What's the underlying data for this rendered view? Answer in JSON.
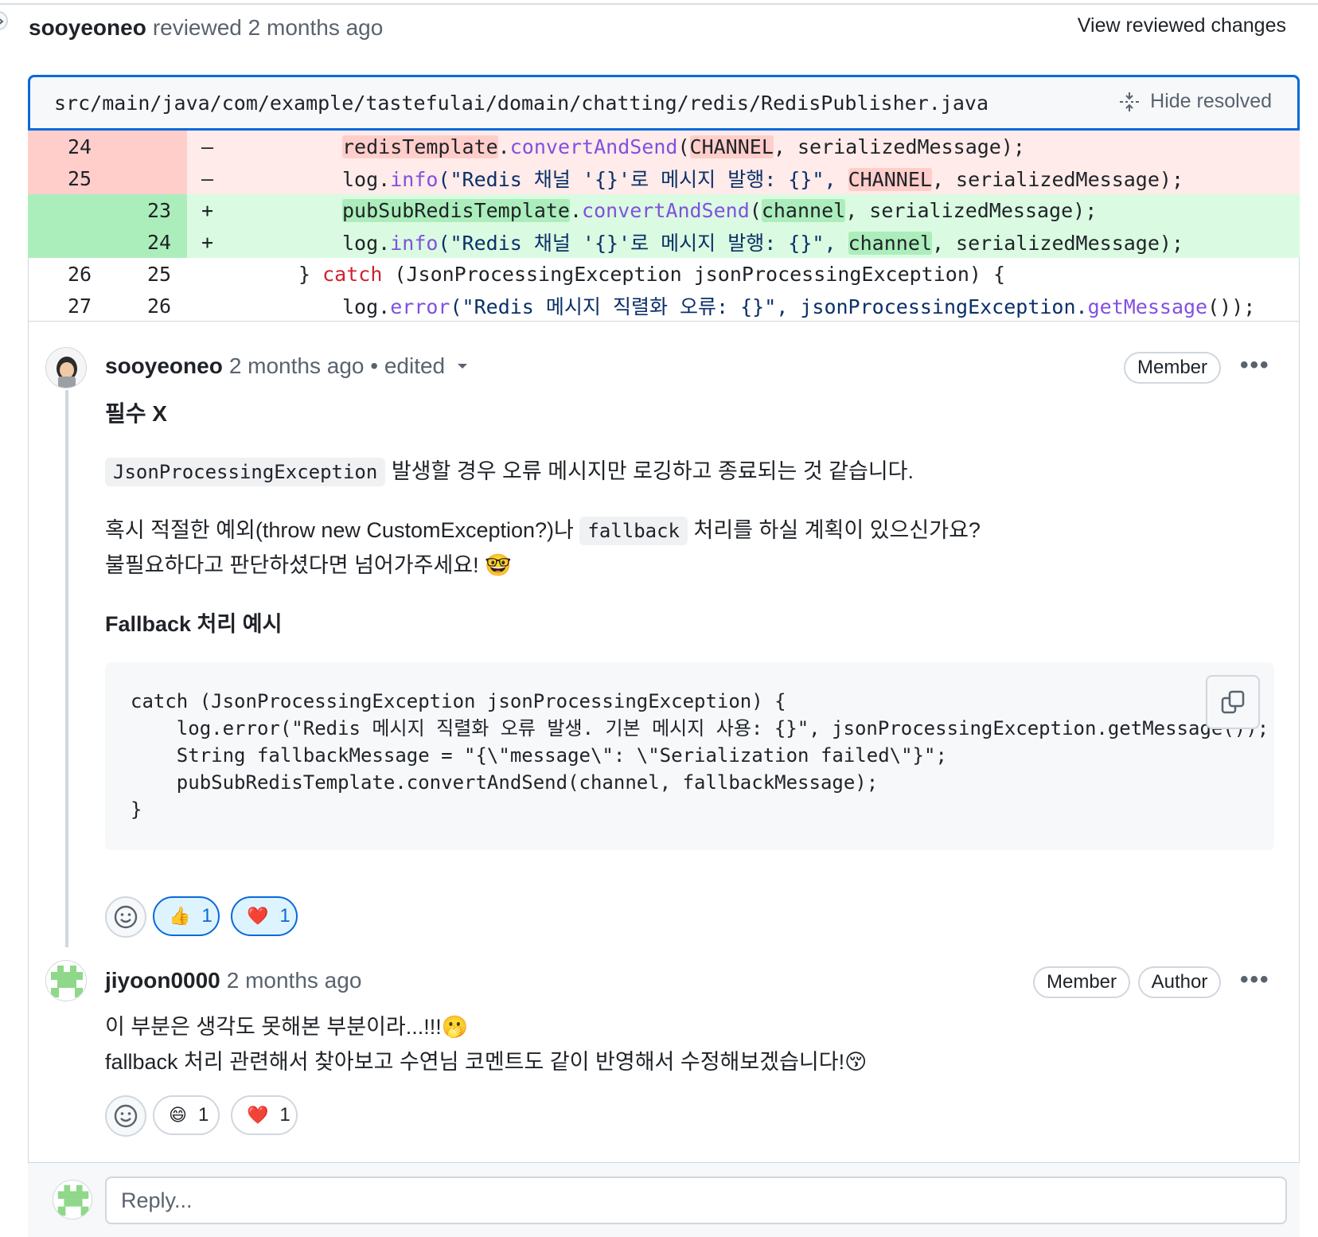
{
  "review": {
    "author": "sooyeoneo",
    "meta": "reviewed 2 months ago",
    "view_changes": "View reviewed changes"
  },
  "file": {
    "path": "src/main/java/com/example/tastefulai/domain/chatting/redis/RedisPublisher.java",
    "hide_resolved": "Hide resolved"
  },
  "diff": {
    "rows": [
      {
        "type": "del",
        "old": "24",
        "new": "",
        "marker": "–"
      },
      {
        "type": "del",
        "old": "25",
        "new": "",
        "marker": "–"
      },
      {
        "type": "add",
        "old": "",
        "new": "23",
        "marker": "+"
      },
      {
        "type": "add",
        "old": "",
        "new": "24",
        "marker": "+"
      },
      {
        "type": "ctx",
        "old": "26",
        "new": "25",
        "marker": ""
      },
      {
        "type": "ctx",
        "old": "27",
        "new": "26",
        "marker": ""
      }
    ],
    "code": {
      "r1_a": "redisTemplate",
      "r1_b": ".",
      "r1_c": "convertAndSend",
      "r1_d": "(",
      "r1_e": "CHANNEL",
      "r1_f": ", serializedMessage);",
      "r2_a": "log.",
      "r2_b": "info",
      "r2_c": "(\"Redis 채널 '{}'로 메시지 발행: {}\", ",
      "r2_d": "CHANNEL",
      "r2_e": ", serializedMessage);",
      "r3_a": "pubSubRedisTemplate",
      "r3_b": ".",
      "r3_c": "convertAndSend",
      "r3_d": "(",
      "r3_e": "channel",
      "r3_f": ", serializedMessage);",
      "r4_a": "log.",
      "r4_b": "info",
      "r4_c": "(\"Redis 채널 '{}'로 메시지 발행: {}\", ",
      "r4_d": "channel",
      "r4_e": ", serializedMessage);",
      "r5_a": "} ",
      "r5_b": "catch",
      "r5_c": " (JsonProcessingException jsonProcessingException) {",
      "r6_a": "log.",
      "r6_b": "error",
      "r6_c": "(\"Redis 메시지 직렬화 오류: {}\", jsonProcessingException.",
      "r6_d": "getMessage",
      "r6_e": "());"
    }
  },
  "comment1": {
    "author": "sooyeoneo",
    "meta": "2 months ago • edited",
    "badge": "Member",
    "kebab": "•••",
    "heading": "필수 X",
    "p1_code": "JsonProcessingException",
    "p1_text": " 발생할 경우 오류 메시지만 로깅하고 종료되는 것 같습니다.",
    "p2_a": "혹시 적절한 예외(throw new CustomException?)나 ",
    "p2_code": "fallback",
    "p2_b": " 처리를 하실 계획이 있으신가요?",
    "p3": "불필요하다고 판단하셨다면 넘어가주세요! 🤓",
    "subheading": "Fallback 처리 예시",
    "code_block": "catch (JsonProcessingException jsonProcessingException) {\n    log.error(\"Redis 메시지 직렬화 오류 발생. 기본 메시지 사용: {}\", jsonProcessingException.getMessage());\n    String fallbackMessage = \"{\\\"message\\\": \\\"Serialization failed\\\"}\";\n    pubSubRedisTemplate.convertAndSend(channel, fallbackMessage);\n}",
    "reactions": [
      {
        "emoji": "👍",
        "count": "1"
      },
      {
        "emoji": "❤️",
        "count": "1"
      }
    ]
  },
  "comment2": {
    "author": "jiyoon0000",
    "meta": "2 months ago",
    "badge_member": "Member",
    "badge_author": "Author",
    "kebab": "•••",
    "line1": "이 부분은 생각도 못해본 부분이라...!!!🫢",
    "line2": "fallback 처리 관련해서 찾아보고 수연님 코멘트도 같이 반영해서 수정해보겠습니다!😚",
    "reactions": [
      {
        "emoji": "😄",
        "count": "1"
      },
      {
        "emoji": "❤️",
        "count": "1"
      }
    ]
  },
  "reply": {
    "placeholder": "Reply..."
  },
  "colors": {
    "accent": "#0969da",
    "del_bg": "#ffebe9",
    "add_bg": "#dafbe1"
  }
}
